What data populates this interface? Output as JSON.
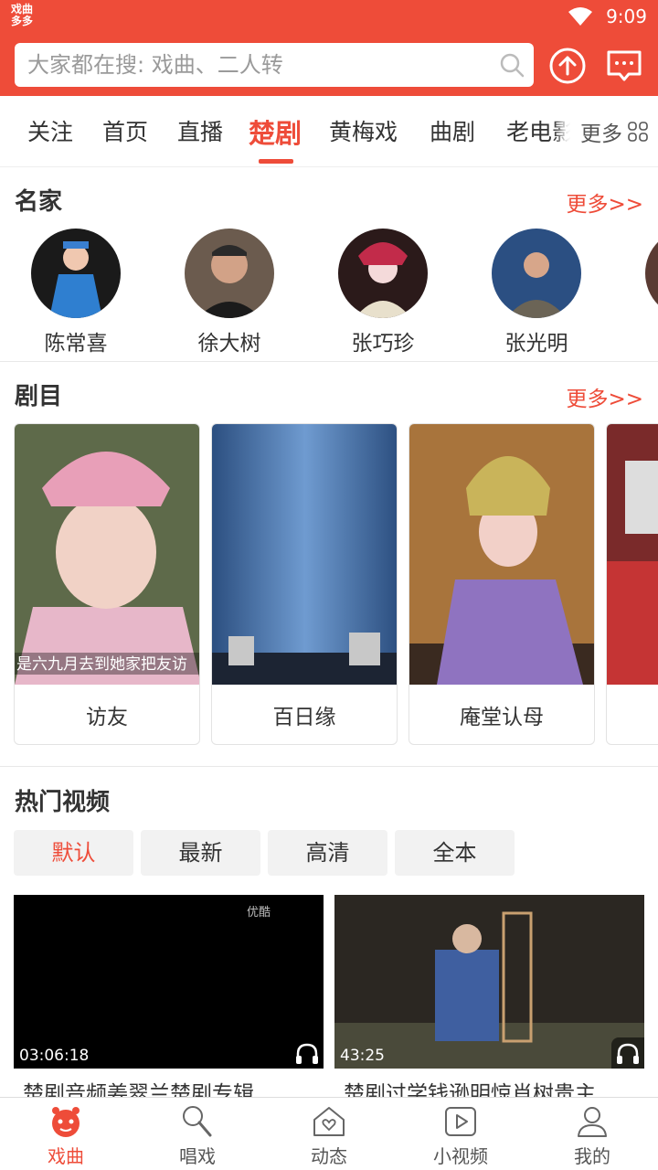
{
  "status": {
    "badge_line1": "戏曲",
    "badge_line2": "多多",
    "time": "9:09"
  },
  "search": {
    "placeholder": "大家都在搜: 戏曲、二人转"
  },
  "tabs": [
    {
      "label": "关注"
    },
    {
      "label": "首页"
    },
    {
      "label": "直播"
    },
    {
      "label": "楚剧"
    },
    {
      "label": "黄梅戏"
    },
    {
      "label": "曲剧"
    },
    {
      "label": "老电影"
    }
  ],
  "tabs_more_label": "更多",
  "artists": {
    "title": "名家",
    "more": "更多>>",
    "items": [
      {
        "name": "陈常喜"
      },
      {
        "name": "徐大树"
      },
      {
        "name": "张巧珍"
      },
      {
        "name": "张光明"
      }
    ]
  },
  "plays": {
    "title": "剧目",
    "more": "更多>>",
    "items": [
      {
        "title": "访友",
        "subtitle_text": "是六九月去到她家把友访"
      },
      {
        "title": "百日缘"
      },
      {
        "title": "庵堂认母"
      },
      {
        "title": ""
      }
    ]
  },
  "hot": {
    "title": "热门视频",
    "filters": [
      {
        "label": "默认"
      },
      {
        "label": "最新"
      },
      {
        "label": "高清"
      },
      {
        "label": "全本"
      }
    ],
    "videos": [
      {
        "duration": "03:06:18",
        "title": "楚剧音频姜翠兰楚剧专辑",
        "watermark": "优酷"
      },
      {
        "duration": "43:25",
        "title": "楚剧过学钱逊明惊肖树贵主"
      }
    ]
  },
  "bottom_nav": [
    {
      "label": "戏曲"
    },
    {
      "label": "唱戏"
    },
    {
      "label": "动态"
    },
    {
      "label": "小视频"
    },
    {
      "label": "我的"
    }
  ],
  "colors": {
    "accent": "#ee4c39"
  }
}
